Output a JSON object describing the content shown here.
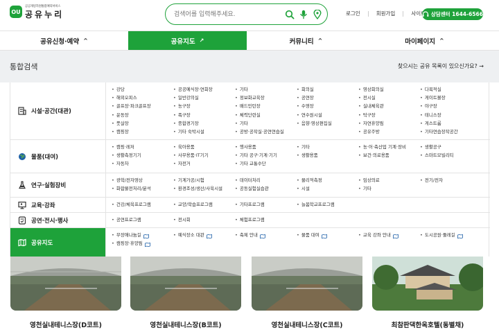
{
  "header": {
    "logo_mark": "OU",
    "logo_sub": "공공개방자원통합예약서비스",
    "logo_name": "공유누리",
    "search_placeholder": "검색어를 입력해주세요.",
    "utils": [
      "로그인",
      "회원가입",
      "사이트맵"
    ],
    "callcenter": "상담센터 1644-6566"
  },
  "nav": {
    "items": [
      {
        "label": "공유신청·예약",
        "marker": "^"
      },
      {
        "label": "공유지도",
        "marker": "↗"
      },
      {
        "label": "커뮤니티",
        "marker": "^"
      },
      {
        "label": "마이페이지",
        "marker": "^"
      }
    ]
  },
  "subbar": {
    "title": "통합검색",
    "link": "찾으시는 공유 목록이 있으신가요? →"
  },
  "categories": [
    {
      "label": "시설·공간(대관)",
      "icon": "building-icon",
      "columns": [
        [
          "강당",
          "해외오피스",
          "골프장·파크골프장",
          "운동장",
          "풋살장",
          "캠핑장"
        ],
        [
          "공공예식장·연회장",
          "일반강의실",
          "농구장",
          "족구장",
          "종합경기장",
          "기타 숙박시설"
        ],
        [
          "기타",
          "정보화교육장",
          "배드민턴장",
          "체력단련실",
          "기타",
          "공방·공작실·공연연습실"
        ],
        [
          "회의실",
          "공연장",
          "수영장",
          "연수원시설",
          "음향·영상편집실"
        ],
        [
          "영상회의실",
          "전시실",
          "실내체육관",
          "탁구장",
          "자연휴양림",
          "공유주방"
        ],
        [
          "다목적실",
          "게이트볼장",
          "야구장",
          "테니스장",
          "게스트룸",
          "기타연습장작공간"
        ]
      ]
    },
    {
      "label": "물품(대여)",
      "icon": "globe-icon",
      "columns": [
        [
          "캠핑·레저",
          "생활측정기기",
          "자동차"
        ],
        [
          "육아용품",
          "사무용품·IT기기",
          "자전거"
        ],
        [
          "행사용품",
          "기타 공구·기계·기기",
          "기타 교통수단"
        ],
        [
          "기타",
          "생활용품"
        ],
        [
          "농·어·축산업 기계·장비",
          "보건·의료용품"
        ],
        [
          "생활공구",
          "스마트모빌리티"
        ]
      ]
    },
    {
      "label": "연구·실험장비",
      "icon": "flask-icon",
      "columns": [
        [
          "광학/전자영상",
          "화합물전처리/분석"
        ],
        [
          "기계가공/시험",
          "환경조성/생산/사육시설"
        ],
        [
          "데이터처리",
          "공동실험실습관"
        ],
        [
          "물리적측정",
          "시설"
        ],
        [
          "임상의료",
          "기타"
        ],
        [
          "전기/전자"
        ]
      ]
    },
    {
      "label": "교육·강좌",
      "icon": "monitor-icon",
      "columns": [
        [
          "건강/체육프로그램"
        ],
        [
          "교양/학습프로그램"
        ],
        [
          "기타프로그램"
        ],
        [
          "늘봄학교프로그램"
        ]
      ]
    },
    {
      "label": "공연·전시·행사",
      "icon": "ticket-icon",
      "columns": [
        [
          "공연프로그램"
        ],
        [
          "전시회"
        ],
        [
          "체험프로그램"
        ]
      ]
    },
    {
      "label": "공유지도",
      "icon": "map-icon",
      "columns": [
        [
          "무장애나눔길"
        ],
        [
          "예식장소 대관"
        ],
        [
          "축제 안내"
        ],
        [
          "물품 대여"
        ],
        [
          "교육 강좌 안내"
        ],
        [
          "도시공원·둘레길"
        ]
      ],
      "extra": [
        "캠핑장·휴양림"
      ]
    }
  ],
  "cards": [
    {
      "title": "영천실내테니스장(D코트)"
    },
    {
      "title": "영천실내테니스장(B코트)"
    },
    {
      "title": "영천실내테니스장(C코트)"
    },
    {
      "title": "최참판댁한옥호텔(동별채)"
    }
  ],
  "colors": {
    "accent": "#1ea23a",
    "subbar_bg": "#eef0f2"
  }
}
